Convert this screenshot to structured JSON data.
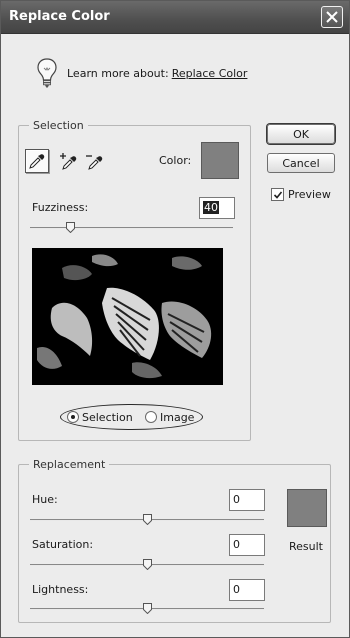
{
  "window": {
    "title": "Replace Color"
  },
  "tip": {
    "text": "Learn more about:",
    "link": "Replace Color"
  },
  "selection": {
    "legend": "Selection",
    "color_label": "Color:",
    "color_swatch": "#808080",
    "fuzziness_label": "Fuzziness:",
    "fuzziness_value": "40",
    "fuzziness_level": 0.2,
    "mode_options": [
      {
        "label": "Selection",
        "selected": true
      },
      {
        "label": "Image",
        "selected": false
      }
    ]
  },
  "buttons": {
    "ok": "OK",
    "cancel": "Cancel"
  },
  "preview": {
    "label": "Preview",
    "checked": true
  },
  "replacement": {
    "legend": "Replacement",
    "hue_label": "Hue:",
    "hue_value": "0",
    "saturation_label": "Saturation:",
    "saturation_value": "0",
    "lightness_label": "Lightness:",
    "lightness_value": "0",
    "result_label": "Result",
    "result_swatch": "#808080"
  },
  "icons": [
    "close-icon",
    "lightbulb-icon",
    "eyedropper-icon",
    "eyedropper-plus-icon",
    "eyedropper-minus-icon"
  ]
}
